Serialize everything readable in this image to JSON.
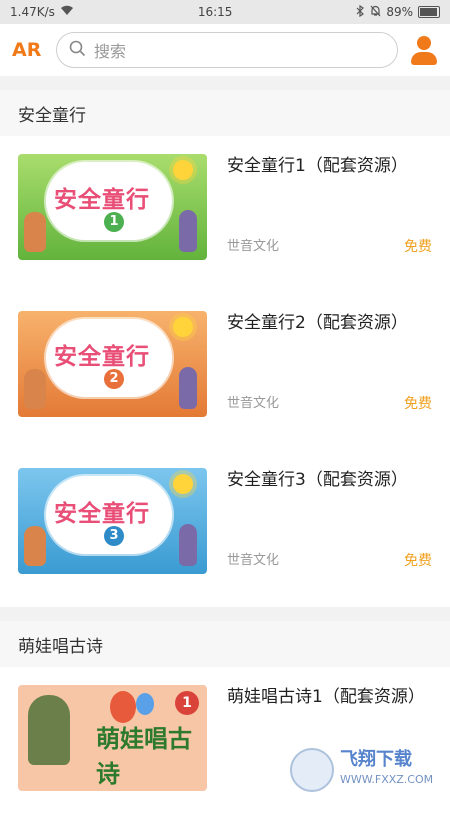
{
  "status": {
    "speed": "1.47K/s",
    "time": "16:15",
    "battery": "89%"
  },
  "header": {
    "ar_label": "AR",
    "search_placeholder": "搜索"
  },
  "sections": [
    {
      "title": "安全童行",
      "items": [
        {
          "title": "安全童行1（配套资源）",
          "publisher": "世音文化",
          "price": "免费",
          "cover_num": "1",
          "cover_color": "#8fd0ff",
          "num_color": "#4caf50"
        },
        {
          "title": "安全童行2（配套资源）",
          "publisher": "世音文化",
          "price": "免费",
          "cover_num": "2",
          "cover_color": "#f5a35c",
          "num_color": "#e8703a"
        },
        {
          "title": "安全童行3（配套资源）",
          "publisher": "世音文化",
          "price": "免费",
          "cover_num": "3",
          "cover_color": "#5fb4e6",
          "num_color": "#2e8bc8"
        }
      ]
    },
    {
      "title": "萌娃唱古诗",
      "items": [
        {
          "title": "萌娃唱古诗1（配套资源）",
          "cover_text": "萌娃唱古诗",
          "cover_num": "1"
        }
      ]
    }
  ],
  "cover_text": "安全童行",
  "watermark": {
    "line1": "飞翔下载",
    "line2": "WWW.FXXZ.COM"
  }
}
